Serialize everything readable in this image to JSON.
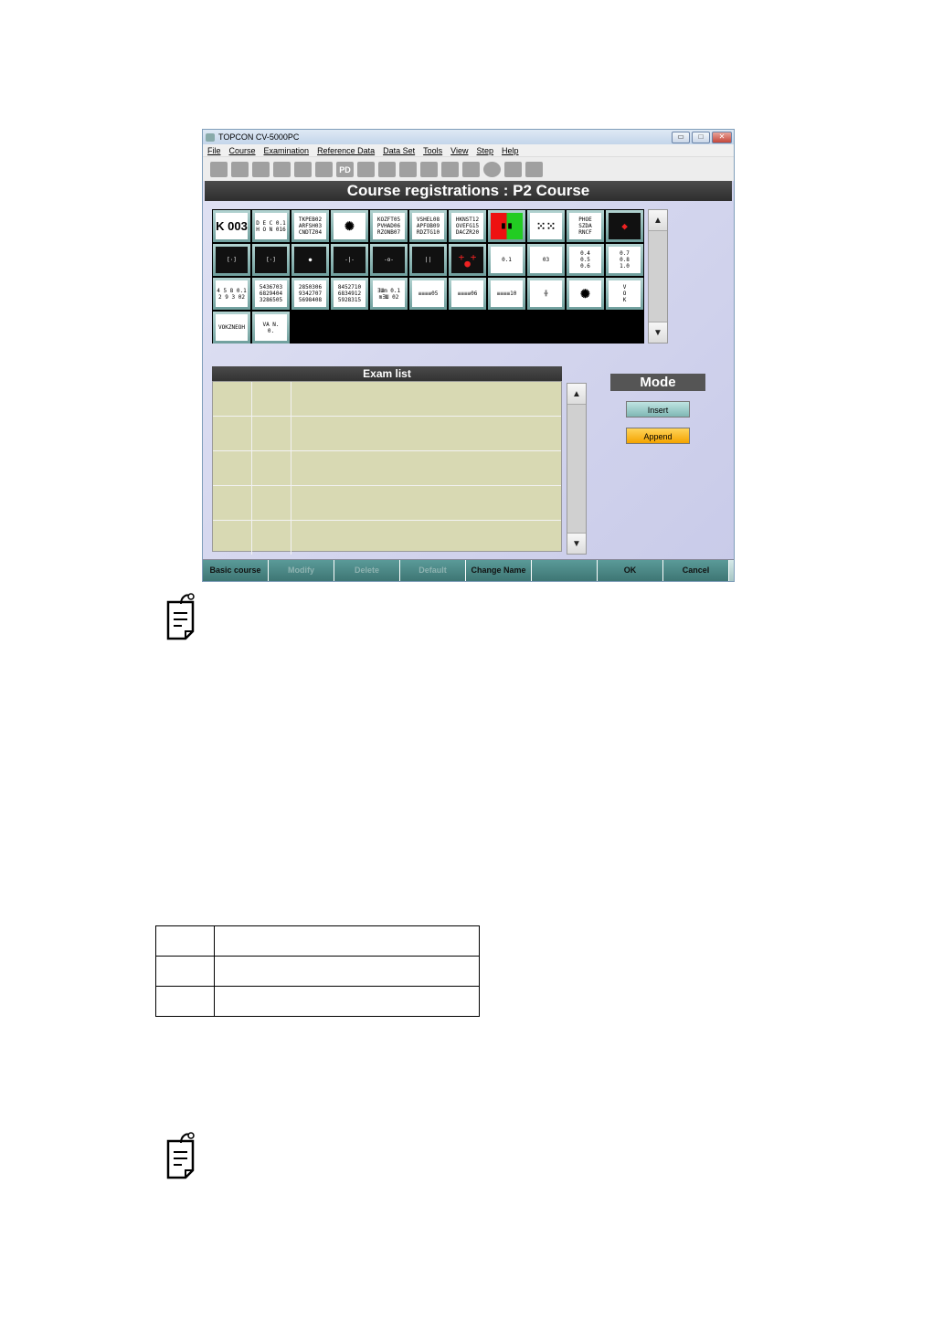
{
  "window": {
    "title": "TOPCON CV-5000PC",
    "controls": [
      "▭",
      "□",
      "✕"
    ]
  },
  "menu": [
    "File",
    "Course",
    "Examination",
    "Reference Data",
    "Data Set",
    "Tools",
    "View",
    "Step",
    "Help"
  ],
  "toolbar": {
    "pd_label": "PD",
    "icons": [
      "patient-icon",
      "person-icon",
      "glasses-icon",
      "lens-icon",
      "data-icon",
      "card-icon",
      "pd-icon",
      "square-icon",
      "va-icon",
      "grid-icon",
      "speech-icon",
      "speech2-icon",
      "book-icon",
      "circle-icon",
      "person2-icon",
      "wrench-icon"
    ]
  },
  "header": {
    "title": "Course registrations : P2 Course"
  },
  "charts": [
    {
      "text": "K 003",
      "style": "big"
    },
    {
      "text": "D E C 0.1\nH O N 016",
      "style": "light"
    },
    {
      "text": "TKPEB02\nARFSH03\nCNDTZ04",
      "style": "light"
    },
    {
      "text": "✺",
      "style": "big"
    },
    {
      "text": "KOZFT05\nPVHAD06\nRZONB07",
      "style": "light"
    },
    {
      "text": "VSHEL08\nAPFOB09\nRDZTG10",
      "style": "light"
    },
    {
      "text": "HKNST12\nOVEFG15\nDACZR20",
      "style": "light"
    },
    {
      "text": "▇ ▇",
      "style": "redgreen"
    },
    {
      "text": "⁙⁙",
      "style": "big"
    },
    {
      "text": "PHOE\nSZDA\nRNCF",
      "style": "light"
    },
    {
      "text": "◆",
      "style": "dots"
    },
    {
      "text": "[·]",
      "style": "dark"
    },
    {
      "text": "[·]",
      "style": "dark"
    },
    {
      "text": "●",
      "style": "dark"
    },
    {
      "text": "-|-",
      "style": "dark"
    },
    {
      "text": "-o-",
      "style": "dark"
    },
    {
      "text": "||",
      "style": "dark"
    },
    {
      "text": "+ +\n●",
      "style": "dots"
    },
    {
      "text": "0.1",
      "style": "light"
    },
    {
      "text": "03",
      "style": "light"
    },
    {
      "text": "0.4\n0.5\n0.6",
      "style": "light"
    },
    {
      "text": "0.7\n0.8\n1.0",
      "style": "light"
    },
    {
      "text": "4 5 8 0.1\n2 9 3 02",
      "style": "light"
    },
    {
      "text": "5436703\n6829404\n3286505",
      "style": "light"
    },
    {
      "text": "2850306\n9342707\n5698408",
      "style": "light"
    },
    {
      "text": "8452710\n6834912\n5928315",
      "style": "light"
    },
    {
      "text": "ƎШm 0.1\nmƎШ 02",
      "style": "light"
    },
    {
      "text": "≡≡≡≡05",
      "style": "light"
    },
    {
      "text": "≡≡≡≡06",
      "style": "light"
    },
    {
      "text": "≡≡≡≡10",
      "style": "light"
    },
    {
      "text": "╬",
      "style": "light"
    },
    {
      "text": "✺",
      "style": "big"
    },
    {
      "text": "V\nO\nK",
      "style": "light"
    },
    {
      "text": "VOKZNEOH",
      "style": "light"
    },
    {
      "text": "VA N.\n0.",
      "style": "light"
    }
  ],
  "exam": {
    "title": "Exam list",
    "rows": 5
  },
  "mode": {
    "title": "Mode",
    "insert": "Insert",
    "append": "Append"
  },
  "bottom": [
    {
      "label": "Basic course",
      "enabled": true
    },
    {
      "label": "Modify",
      "enabled": false
    },
    {
      "label": "Delete",
      "enabled": false
    },
    {
      "label": "Default",
      "enabled": false
    },
    {
      "label": "Change Name",
      "enabled": true
    },
    {
      "label": "",
      "enabled": true
    },
    {
      "label": "OK",
      "enabled": true
    },
    {
      "label": "Cancel",
      "enabled": true
    }
  ],
  "scroll": {
    "up": "▲",
    "down": "▼"
  }
}
